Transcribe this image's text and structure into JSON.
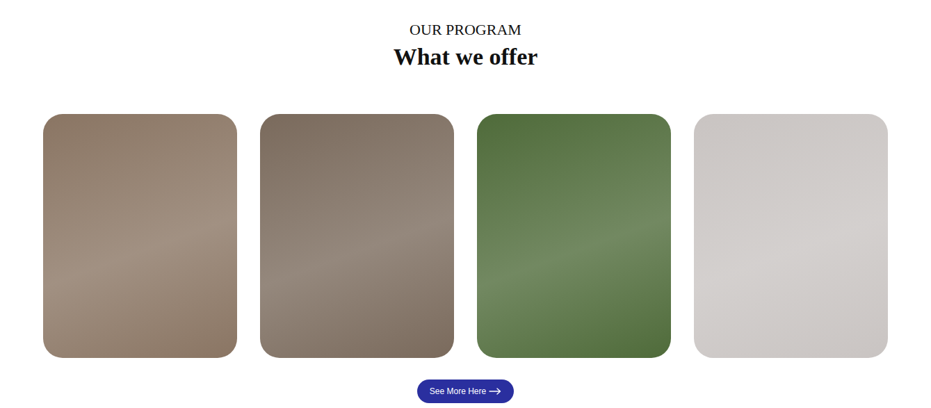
{
  "section": {
    "eyebrow": "OUR PROGRAM",
    "title": "What we offer"
  },
  "cards": [
    {
      "color": "#8a7563"
    },
    {
      "color": "#7a6a5c"
    },
    {
      "color": "#4f6b3a"
    },
    {
      "color": "#c9c4c2"
    }
  ],
  "button": {
    "label": "See More Here"
  }
}
